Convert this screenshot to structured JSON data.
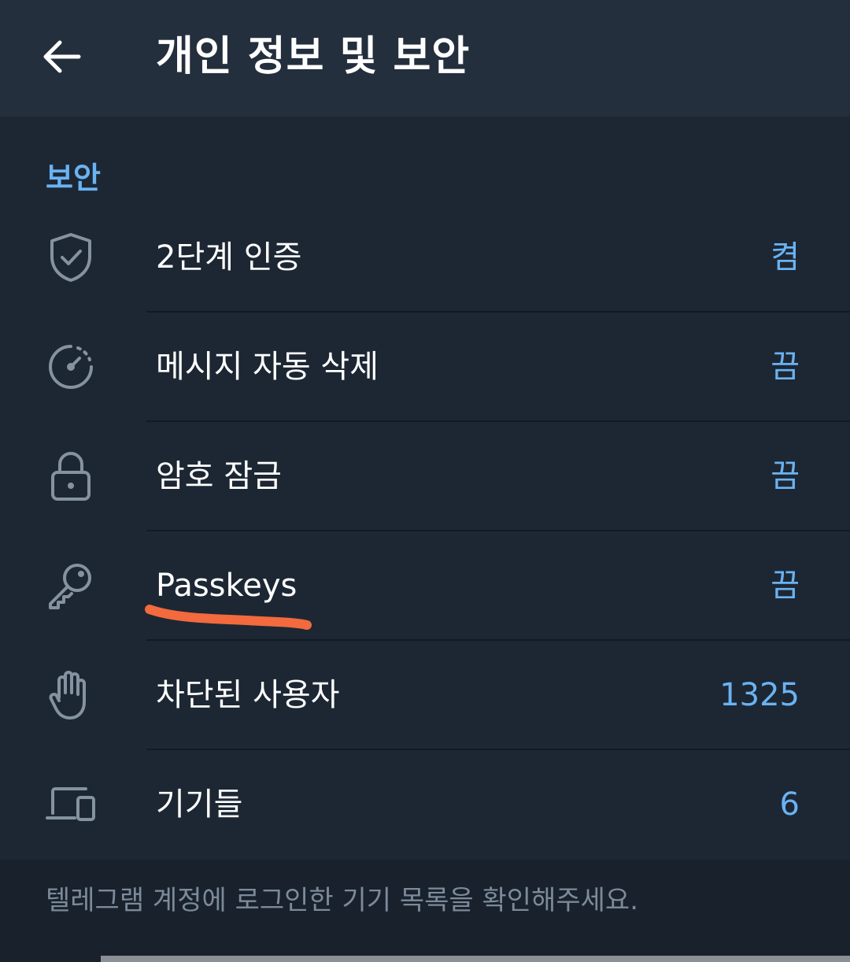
{
  "header": {
    "title": "개인 정보 및 보안"
  },
  "section": {
    "title": "보안"
  },
  "rows": [
    {
      "label": "2단계 인증",
      "value": "켬",
      "icon": "shield-check-icon"
    },
    {
      "label": "메시지 자동 삭제",
      "value": "끔",
      "icon": "timer-icon"
    },
    {
      "label": "암호 잠금",
      "value": "끔",
      "icon": "lock-icon"
    },
    {
      "label": "Passkeys",
      "value": "끔",
      "icon": "key-icon"
    },
    {
      "label": "차단된 사용자",
      "value": "1325",
      "icon": "hand-icon"
    },
    {
      "label": "기기들",
      "value": "6",
      "icon": "devices-icon"
    }
  ],
  "footer": {
    "text": "텔레그램 계정에 로그인한 기기 목록을 확인해주세요."
  },
  "colors": {
    "background": "#1d2733",
    "header": "#242f3d",
    "accent": "#6ab3f3",
    "annotation": "#f26a3d"
  }
}
